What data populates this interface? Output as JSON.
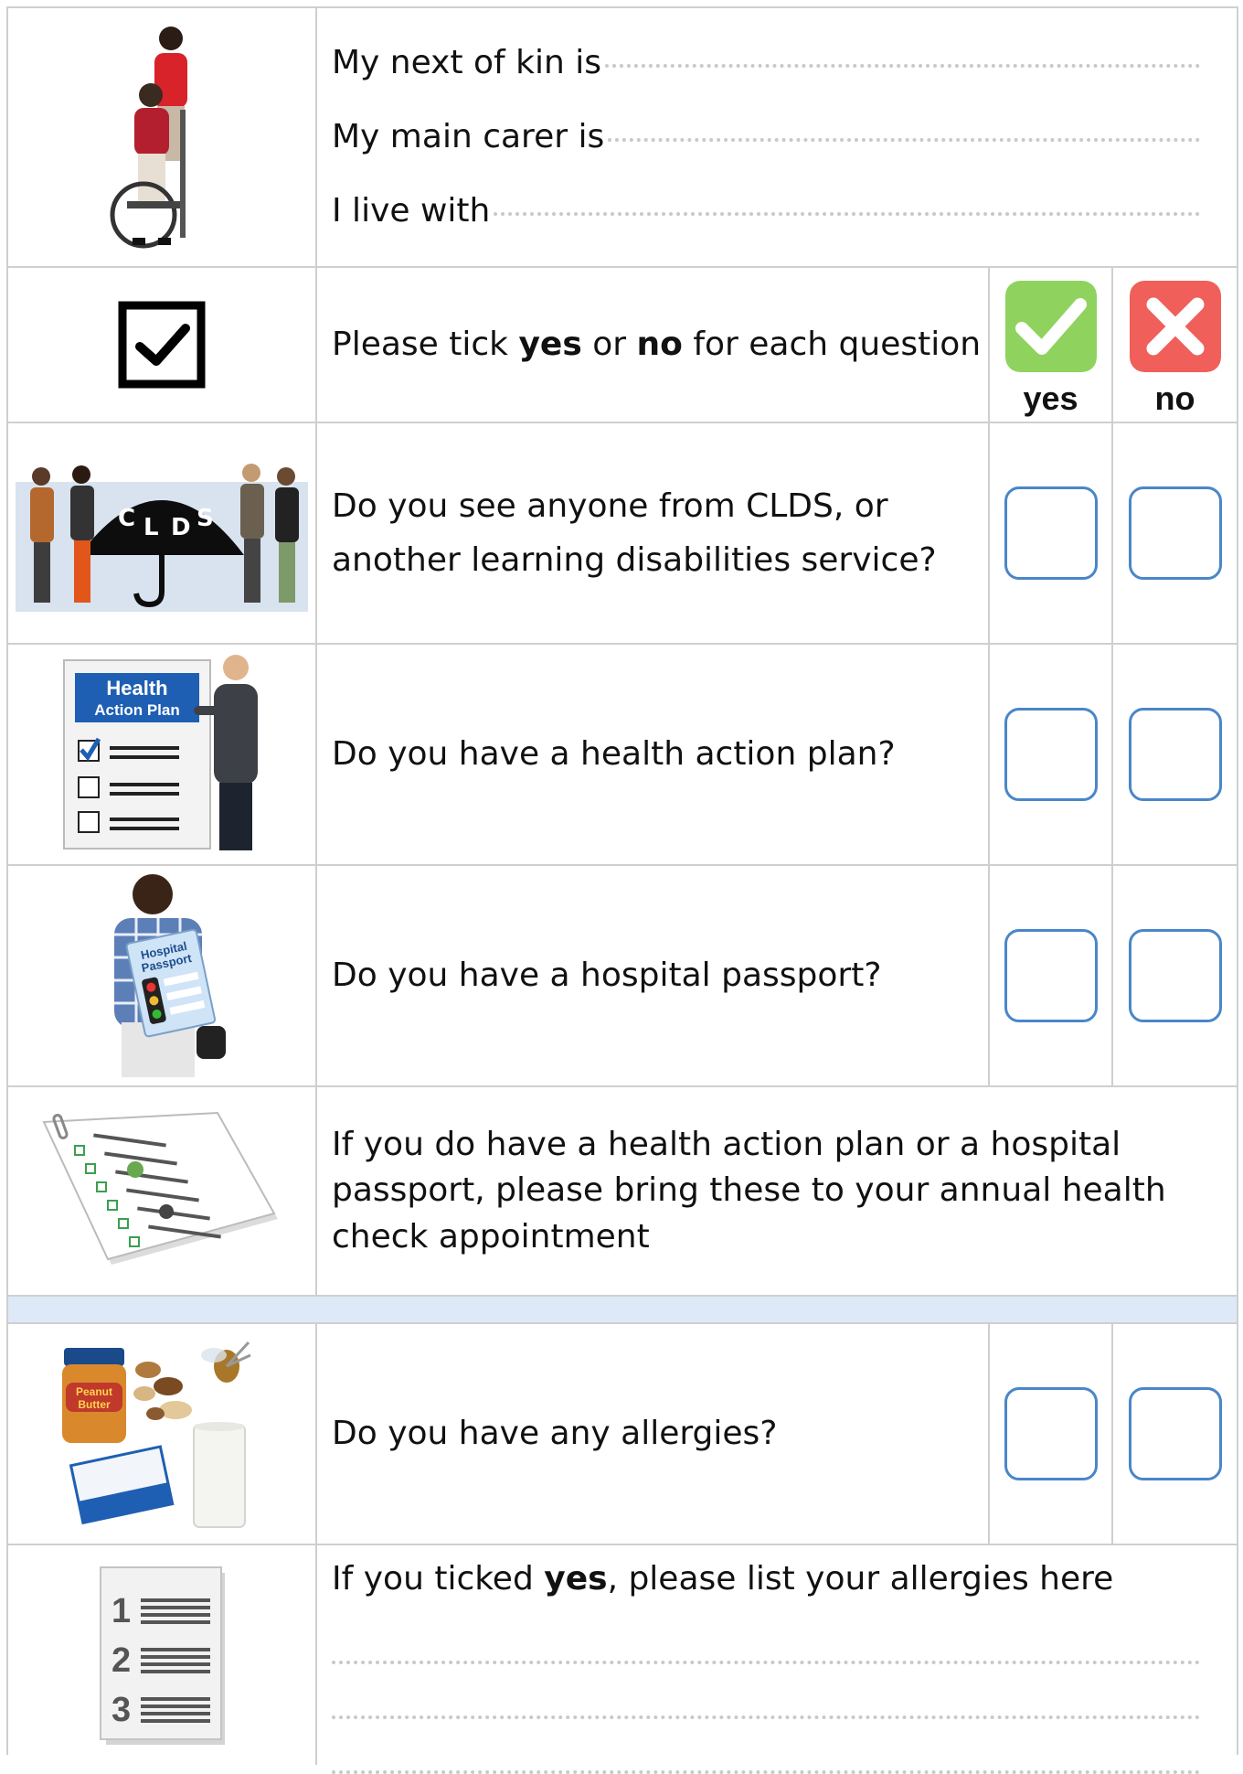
{
  "contacts": {
    "next_of_kin": "My next of kin is",
    "main_carer": "My main carer is",
    "live_with": "I live with"
  },
  "instructions": {
    "prefix": "Please tick ",
    "yes_word": "yes",
    "middle": " or ",
    "no_word": "no",
    "suffix": " for each question",
    "yes_label": "yes",
    "no_label": "no"
  },
  "questions": {
    "clds": "Do you see anyone from CLDS, or another learning disabilities service?",
    "health_plan": "Do you have a health action plan?",
    "passport": "Do you have a hospital passport?",
    "allergies": "Do you have any allergies?"
  },
  "bring_note": "If you do have a health action plan or a hospital passport, please bring these to your annual health check appointment",
  "allergy_list": {
    "prefix": "If you ticked ",
    "yes_word": "yes",
    "suffix": ", please list your allergies here"
  },
  "image_text": {
    "umbrella_letters": [
      "C",
      "L",
      "D",
      "S"
    ],
    "health_plan_title_1": "Health",
    "health_plan_title_2": "Action Plan",
    "passport_line_1": "Hospital",
    "passport_line_2": "Passport",
    "peanut_label_1": "Peanut",
    "peanut_label_2": "Butter",
    "list_numbers": [
      "1",
      "2",
      "3"
    ]
  },
  "colors": {
    "yes_green": "#8fd35e",
    "no_red": "#f05f5a",
    "box_blue": "#4a86c8",
    "separator_blue": "#dde9f6"
  }
}
